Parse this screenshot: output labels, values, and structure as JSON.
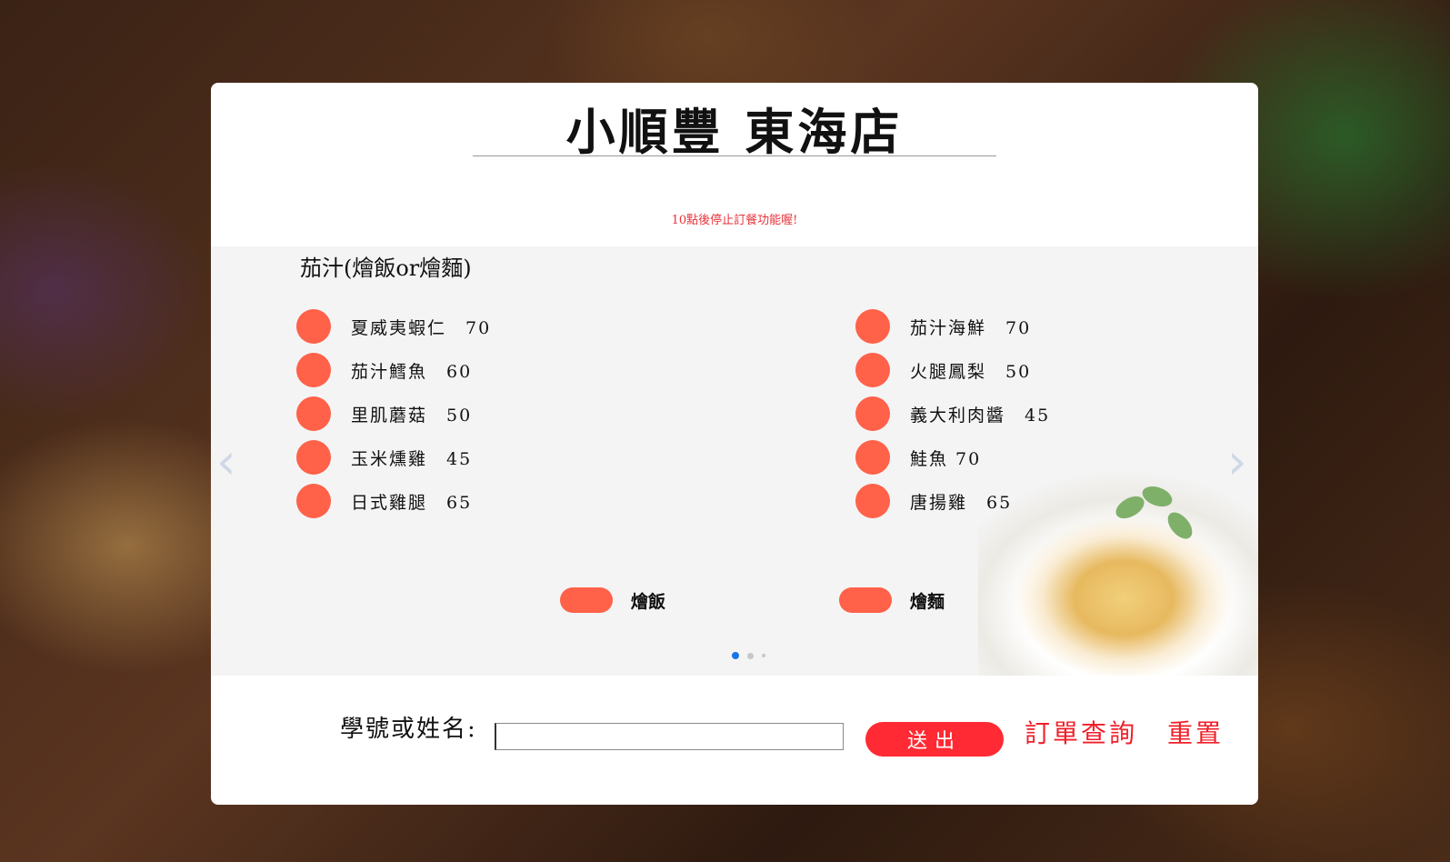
{
  "header": {
    "title": "小順豐 東海店",
    "notice": "10點後停止訂餐功能喔!"
  },
  "menu": {
    "category": "茄汁(燴飯or燴麵)",
    "left_items": [
      {
        "label": "夏威夷蝦仁　70"
      },
      {
        "label": "茄汁鱈魚　60"
      },
      {
        "label": "里肌蘑菇　50"
      },
      {
        "label": "玉米燻雞　45"
      },
      {
        "label": "日式雞腿　65"
      }
    ],
    "right_items": [
      {
        "label": "茄汁海鮮　70"
      },
      {
        "label": "火腿鳳梨　50"
      },
      {
        "label": "義大利肉醬　45"
      },
      {
        "label": "鮭魚 70"
      },
      {
        "label": "唐揚雞　65"
      }
    ],
    "options": [
      {
        "label": "燴飯"
      },
      {
        "label": "燴麵"
      }
    ],
    "carousel": {
      "prev_icon": "‹",
      "next_icon": "›",
      "page_count": 3,
      "active_page": 1
    }
  },
  "form": {
    "label": "學號或姓名:",
    "input_value": "",
    "input_placeholder": "",
    "submit_label": "送出",
    "query_label": "訂單查詢",
    "reset_label": "重置"
  },
  "colors": {
    "accent": "#ff6149",
    "submit": "#ff2a33",
    "link": "#f01f2a",
    "notice": "#e8323a"
  }
}
